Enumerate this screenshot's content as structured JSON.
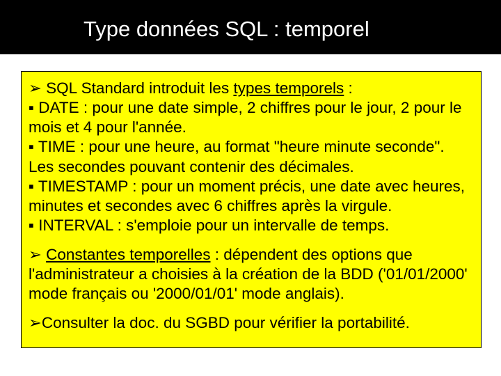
{
  "title": "Type données SQL : temporel",
  "p1": {
    "intro_lead": "SQL Standard introduit les ",
    "intro_term": "types temporels",
    "intro_tail": " :",
    "date": "DATE : pour une date simple, 2 chiffres pour le jour, 2 pour le mois et 4 pour l'année.",
    "time": "TIME : pour une heure, au format \"heure minute seconde\". Les secondes pouvant contenir des décimales.",
    "timestamp": "TIMESTAMP : pour un moment précis, une date avec heures, minutes et secondes avec 6 chiffres après la virgule.",
    "interval": "INTERVAL : s'emploie pour un intervalle de temps."
  },
  "p2": {
    "term": "Constantes temporelles",
    "rest": " : dépendent des options que l'administrateur a choisies à la création de la BDD ('01/01/2000' mode français ou '2000/01/01' mode anglais)."
  },
  "p3": "Consulter la doc. du SGBD pour vérifier la portabilité.",
  "glyphs": {
    "arrow": "➢",
    "square": "▪"
  }
}
